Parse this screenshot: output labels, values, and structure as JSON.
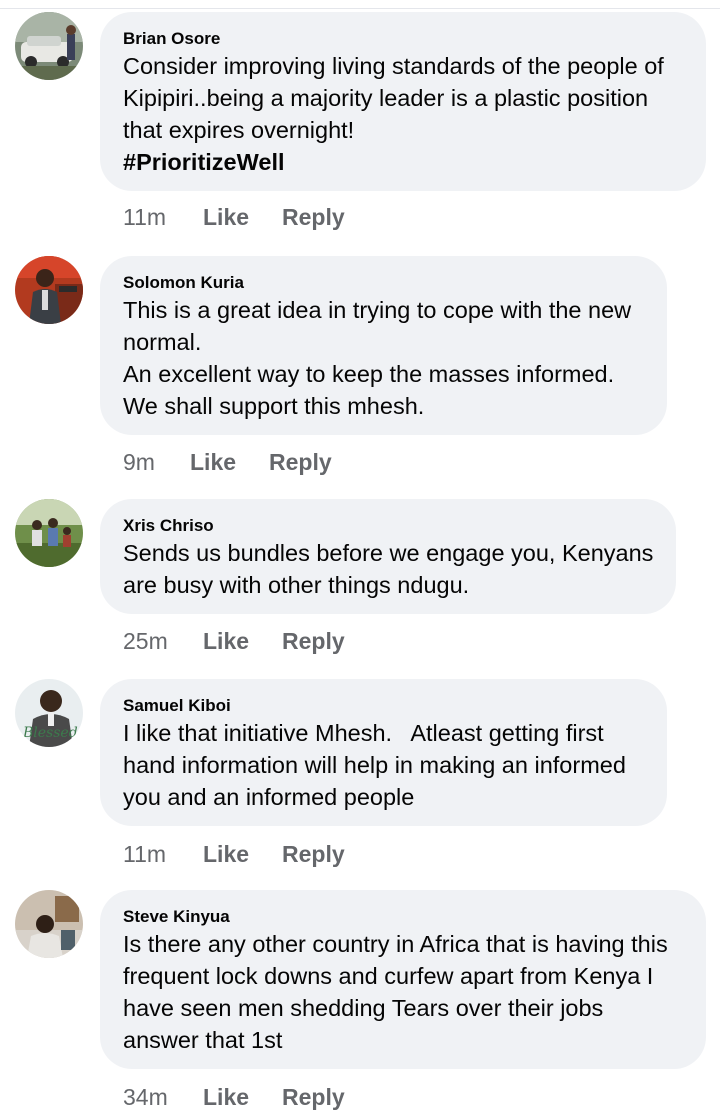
{
  "comments": [
    {
      "author": "Brian Osore",
      "lines": [
        "Consider improving living standards of the people of",
        "Kipipiri..being a majority leader is a plastic position",
        "that expires overnight!",
        "#PrioritizeWell"
      ],
      "time": "11m",
      "like_label": "Like",
      "reply_label": "Reply",
      "avatar_icon": "profile-photo-man-with-car"
    },
    {
      "author": "Solomon Kuria",
      "lines": [
        "This is a great idea in trying to cope with the new",
        "normal.",
        "An excellent way to keep the masses informed.",
        "We shall support this mhesh."
      ],
      "time": "9m",
      "like_label": "Like",
      "reply_label": "Reply",
      "avatar_icon": "profile-photo-man-at-podium"
    },
    {
      "author": "Xris Chriso",
      "lines": [
        "Sends us bundles before we engage you, Kenyans",
        "are busy with other things ndugu."
      ],
      "time": "25m",
      "like_label": "Like",
      "reply_label": "Reply",
      "avatar_icon": "profile-photo-group-outdoors"
    },
    {
      "author": "Samuel Kiboi",
      "lines": [
        "I like that initiative Mhesh.   Atleast getting first",
        "hand information will help in making an informed",
        "you and an informed people"
      ],
      "time": "11m",
      "like_label": "Like",
      "reply_label": "Reply",
      "avatar_icon": "profile-photo-man-blessed"
    },
    {
      "author": "Steve Kinyua",
      "lines": [
        "Is there any other country in Africa that is having this",
        "frequent lock downs and curfew apart from Kenya I",
        "have seen men shedding Tears over their jobs",
        "answer that 1st"
      ],
      "time": "34m",
      "like_label": "Like",
      "reply_label": "Reply",
      "avatar_icon": "profile-photo-man-indoors"
    }
  ],
  "colors": {
    "bubble": "#f0f2f5",
    "text": "#050505",
    "meta": "#65676b"
  }
}
